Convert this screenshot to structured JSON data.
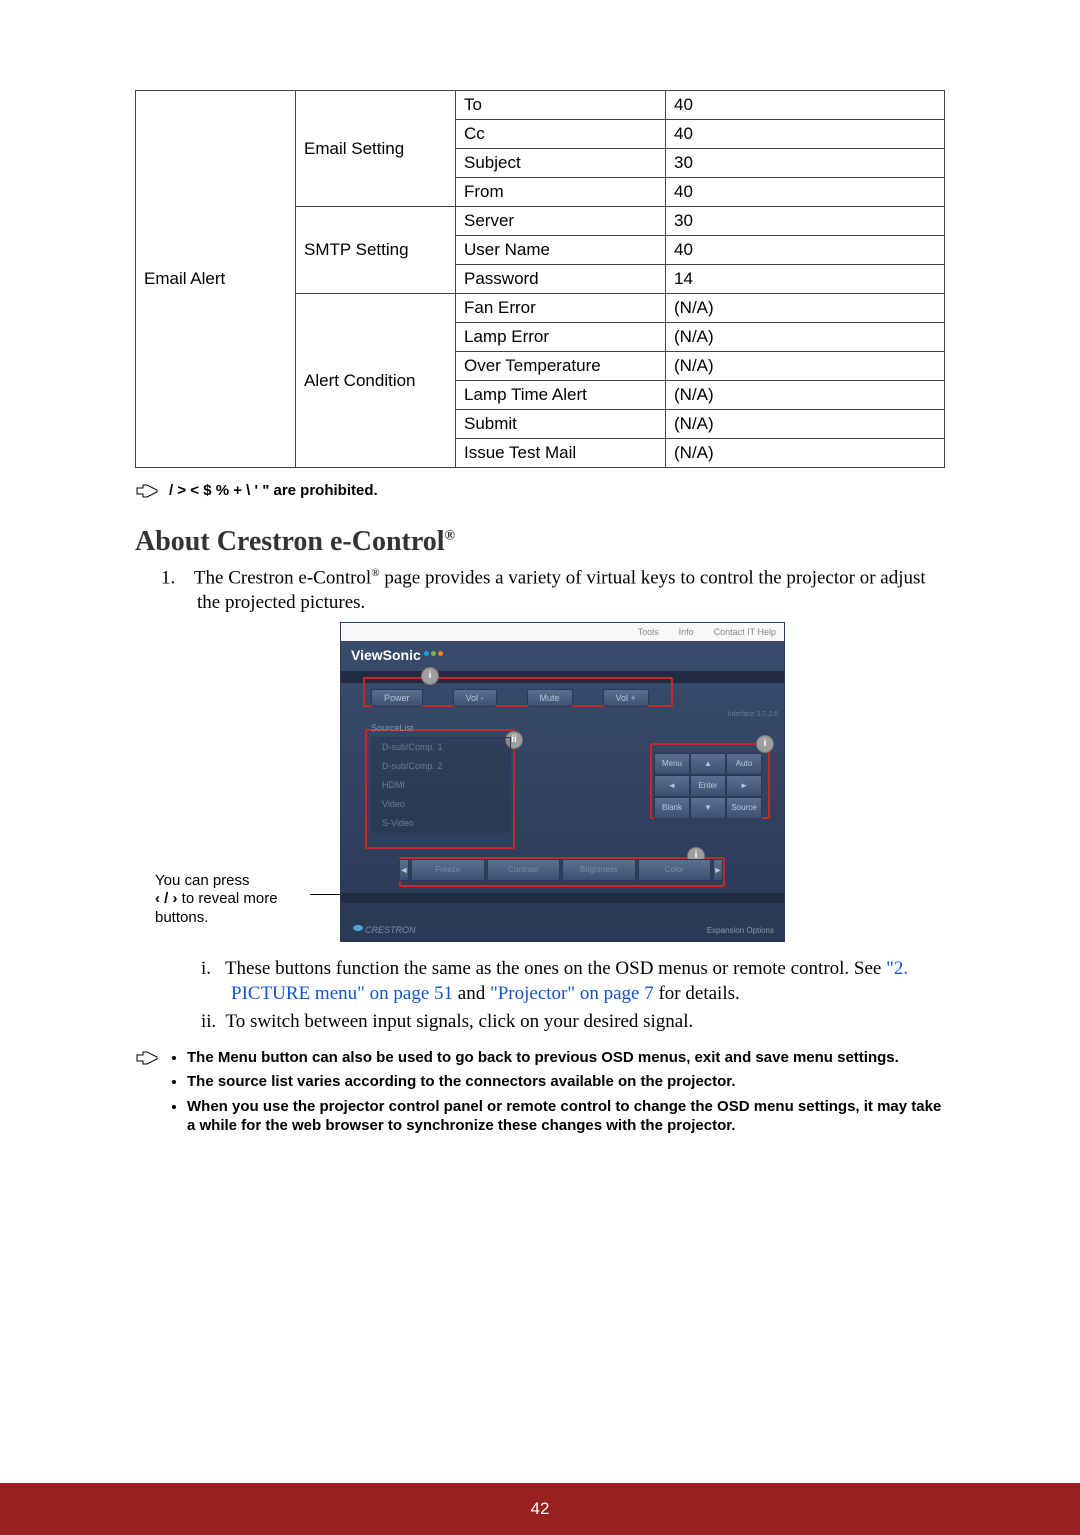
{
  "table": {
    "c0": "Email Alert",
    "groups": [
      {
        "name": "Email Setting",
        "rows": [
          {
            "field": "To",
            "limit": "40"
          },
          {
            "field": "Cc",
            "limit": "40"
          },
          {
            "field": "Subject",
            "limit": "30"
          },
          {
            "field": "From",
            "limit": "40"
          }
        ]
      },
      {
        "name": "SMTP Setting",
        "rows": [
          {
            "field": "Server",
            "limit": "30"
          },
          {
            "field": "User Name",
            "limit": "40"
          },
          {
            "field": "Password",
            "limit": "14"
          }
        ]
      },
      {
        "name": "Alert Condition",
        "rows": [
          {
            "field": "Fan Error",
            "limit": "(N/A)"
          },
          {
            "field": "Lamp Error",
            "limit": "(N/A)"
          },
          {
            "field": "Over Temperature",
            "limit": "(N/A)"
          },
          {
            "field": "Lamp Time Alert",
            "limit": "(N/A)"
          },
          {
            "field": "Submit",
            "limit": "(N/A)"
          },
          {
            "field": "Issue Test Mail",
            "limit": "(N/A)"
          }
        ]
      }
    ]
  },
  "note1": " / > < $ % + \\ ' \"   are prohibited.",
  "heading": {
    "pre": "About Crestron e-Control",
    "sup": "®"
  },
  "para1": {
    "num": "1.",
    "t1": "The Crestron e-Control",
    "sup": "®",
    "t2": " page provides a variety of virtual keys to control the projector or adjust the projected pictures."
  },
  "sidecap": {
    "l1": "You can press ",
    "chev": "‹ / ›",
    "l2": " to reveal more buttons."
  },
  "shot": {
    "top_links": [
      "Tools",
      "Info",
      "Contact IT Help"
    ],
    "logo_main": "ViewSonic",
    "ctrl_labels": [
      "Power",
      "Vol -",
      "Mute",
      "Vol +"
    ],
    "source_label": "SourceList",
    "sources": [
      "D-sub/Comp. 1",
      "D-sub/Comp. 2",
      "HDMI",
      "Video",
      "S-Video"
    ],
    "dpad": {
      "tl": "Menu",
      "tr": "Auto",
      "c": "Enter",
      "bl": "Blank",
      "br": "Source",
      "up": "▲",
      "down": "▼",
      "left": "◄",
      "right": "►"
    },
    "bottom": [
      "Freeze",
      "Contrast",
      "Brightness",
      "Color"
    ],
    "crestron": "CRESTRON",
    "exp": "Expansion Options",
    "iface_ver": "Interface 2.7.2.6"
  },
  "roman": {
    "i": {
      "num": "i.",
      "t1": "These buttons function the same as the ones on the OSD menus or remote control. See ",
      "link1": "\"2. PICTURE menu\" on page 51",
      "mid": " and ",
      "link2": "\"Projector\" on page 7",
      "t2": " for details."
    },
    "ii": {
      "num": "ii.",
      "t": "To switch between input signals, click on your desired signal."
    }
  },
  "note2_items": [
    "The Menu button can also be used to go back to previous OSD menus, exit and save menu settings.",
    "The source list varies according to the connectors available on the projector.",
    "When you use the projector control panel or remote control to change the OSD menu settings, it may take a while for the web browser to synchronize these changes with the projector."
  ],
  "page_num": "42"
}
